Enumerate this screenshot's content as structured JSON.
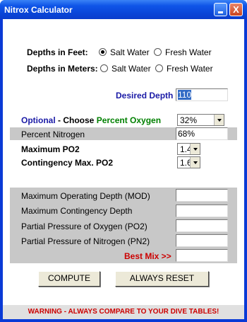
{
  "window": {
    "title": "Nitrox Calculator",
    "minimize_symbol": "_",
    "close_symbol": "X"
  },
  "units": {
    "feet_label": "Depths in Feet:",
    "meters_label": "Depths in Meters:",
    "salt_label": "Salt Water",
    "fresh_label": "Fresh Water",
    "selected": "feet-salt"
  },
  "desired_depth": {
    "label": "Desired Depth",
    "value": "110"
  },
  "oxygen": {
    "optional_label": "Optional",
    "dash": " - Choose ",
    "percent_label": "Percent Oxygen",
    "selected_value": "32%"
  },
  "nitrogen": {
    "label": "Percent Nitrogen",
    "value": "68%"
  },
  "max_po2": {
    "label": "Maximum PO2",
    "value": "1.4"
  },
  "contingency_po2": {
    "label": "Contingency Max. PO2",
    "value": "1.6"
  },
  "results": {
    "mod_label": "Maximum Operating Depth (MOD)",
    "mcd_label": "Maximum Contingency Depth",
    "ppo2_label": "Partial Pressure of Oxygen (PO2)",
    "ppn2_label": "Partial Pressure of Nitrogen (PN2)",
    "best_mix_label": "Best Mix >>",
    "mod_value": "",
    "mcd_value": "",
    "ppo2_value": "",
    "ppn2_value": "",
    "best_mix_value": ""
  },
  "buttons": {
    "compute": "COMPUTE",
    "reset": "ALWAYS RESET"
  },
  "warning": "WARNING - ALWAYS COMPARE TO YOUR DIVE TABLES!",
  "colors": {
    "desired_depth_label": "#1a1aa6",
    "optional_label": "#1a1aa6",
    "percent_oxygen_label": "#008000",
    "best_mix_label": "#cc0000",
    "warning": "#cc0000"
  }
}
